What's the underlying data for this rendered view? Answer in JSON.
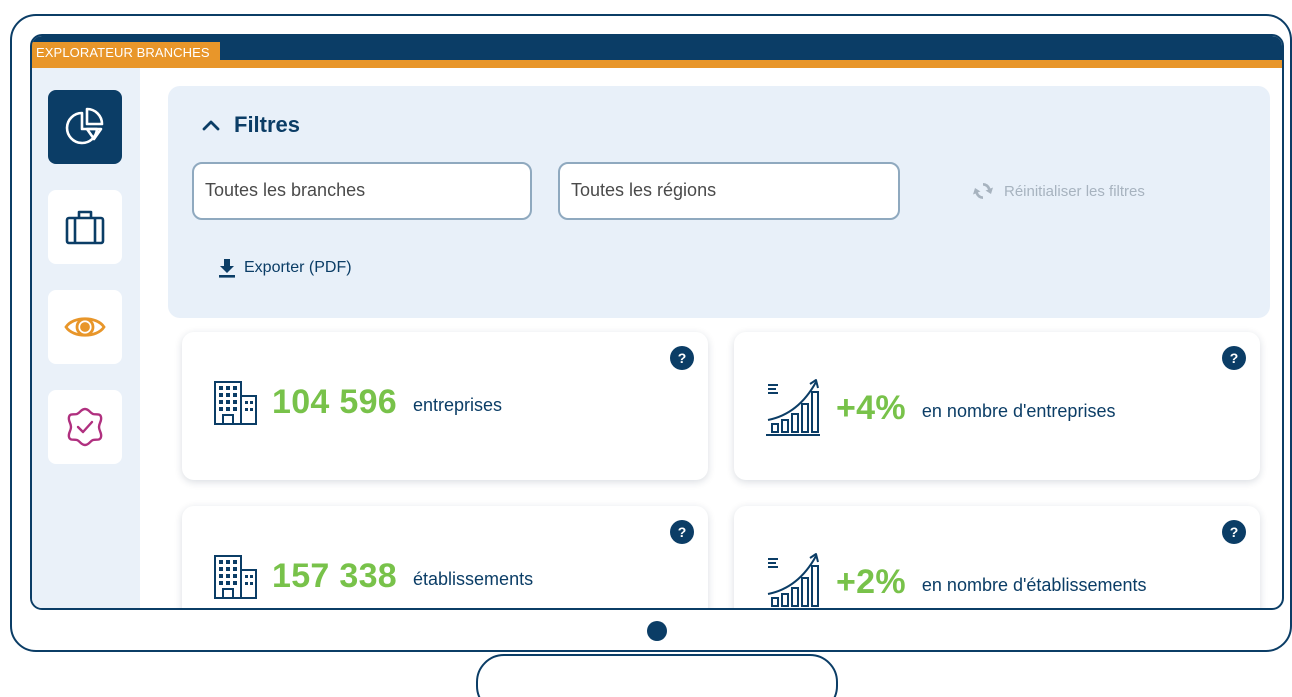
{
  "app": {
    "tab_label": "EXPLORATEUR BRANCHES"
  },
  "sidebar": {
    "items": [
      {
        "icon": "pie-chart-icon",
        "active": true
      },
      {
        "icon": "briefcase-icon",
        "active": false
      },
      {
        "icon": "eye-icon",
        "active": false
      },
      {
        "icon": "badge-check-icon",
        "active": false
      }
    ]
  },
  "filters": {
    "title": "Filtres",
    "branches_placeholder": "Toutes les branches",
    "regions_placeholder": "Toutes les régions",
    "reset_label": "Réinitialiser les filtres",
    "export_label": "Exporter (PDF)"
  },
  "kpis": [
    {
      "value": "104 596",
      "label": "entreprises",
      "icon": "building-icon"
    },
    {
      "value": "+4%",
      "label": "en nombre d'entreprises",
      "icon": "growth-chart-icon"
    },
    {
      "value": "157 338",
      "label": "établissements",
      "icon": "building-icon"
    },
    {
      "value": "+2%",
      "label": "en nombre d'établissements",
      "icon": "growth-chart-icon"
    }
  ],
  "help_label": "?",
  "colors": {
    "navy": "#0b3d66",
    "orange": "#e8962a",
    "green": "#78c24a",
    "panel": "#e8f0f9",
    "magenta": "#b0307f"
  }
}
